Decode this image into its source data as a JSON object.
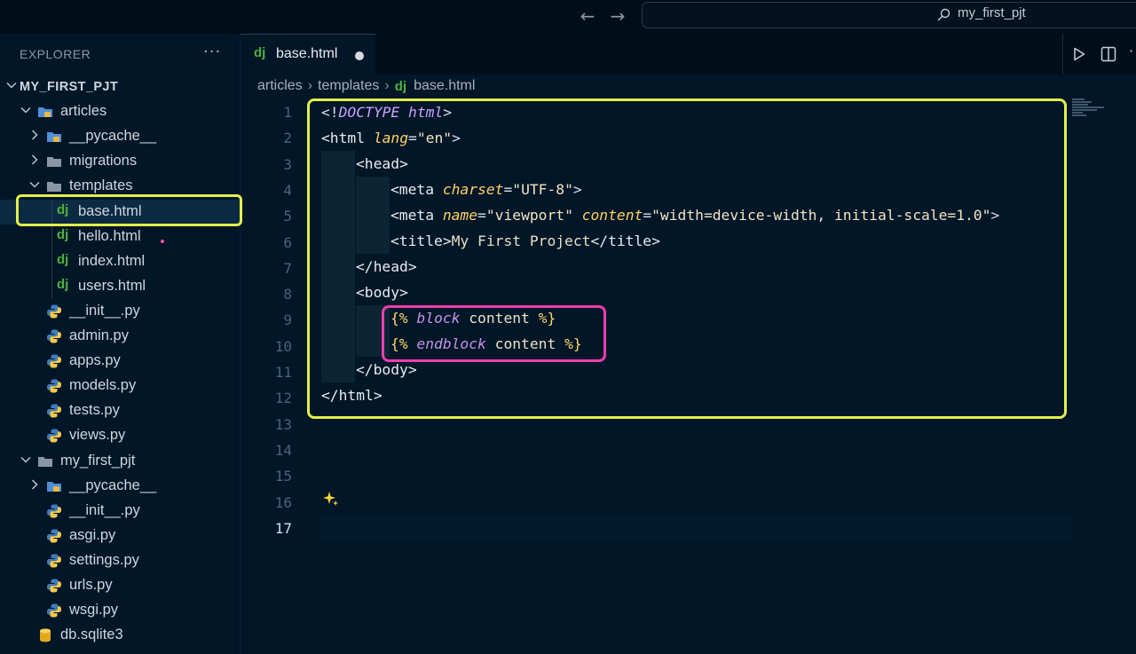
{
  "window": {
    "search_text": "my_first_pjt"
  },
  "explorer": {
    "title": "EXPLORER",
    "more": "···",
    "root": "MY_FIRST_PJT",
    "items": [
      {
        "label": "articles",
        "kind": "folder-open-special",
        "depth": 1
      },
      {
        "label": "__pycache__",
        "kind": "folder-special",
        "depth": 2
      },
      {
        "label": "migrations",
        "kind": "folder",
        "depth": 2
      },
      {
        "label": "templates",
        "kind": "folder-open",
        "depth": 2
      },
      {
        "label": "base.html",
        "kind": "django",
        "depth": 3
      },
      {
        "label": "hello.html",
        "kind": "django",
        "depth": 3
      },
      {
        "label": "index.html",
        "kind": "django",
        "depth": 3
      },
      {
        "label": "users.html",
        "kind": "django",
        "depth": 3
      },
      {
        "label": "__init__.py",
        "kind": "python",
        "depth": 2
      },
      {
        "label": "admin.py",
        "kind": "python",
        "depth": 2
      },
      {
        "label": "apps.py",
        "kind": "python",
        "depth": 2
      },
      {
        "label": "models.py",
        "kind": "python",
        "depth": 2
      },
      {
        "label": "tests.py",
        "kind": "python",
        "depth": 2
      },
      {
        "label": "views.py",
        "kind": "python",
        "depth": 2
      },
      {
        "label": "my_first_pjt",
        "kind": "folder-open",
        "depth": 1
      },
      {
        "label": "__pycache__",
        "kind": "folder-special",
        "depth": 2
      },
      {
        "label": "__init__.py",
        "kind": "python",
        "depth": 2
      },
      {
        "label": "asgi.py",
        "kind": "python",
        "depth": 2
      },
      {
        "label": "settings.py",
        "kind": "python",
        "depth": 2
      },
      {
        "label": "urls.py",
        "kind": "python",
        "depth": 2
      },
      {
        "label": "wsgi.py",
        "kind": "python",
        "depth": 2
      },
      {
        "label": "db.sqlite3",
        "kind": "database",
        "depth": 1
      }
    ]
  },
  "tab": {
    "icon": "dj",
    "label": "base.html"
  },
  "breadcrumb": {
    "parts": [
      "articles",
      "templates",
      "base.html"
    ],
    "file_icon": "dj"
  },
  "editor": {
    "line_numbers": [
      "1",
      "2",
      "3",
      "4",
      "5",
      "6",
      "7",
      "8",
      "9",
      "10",
      "11",
      "12",
      "13",
      "14",
      "15",
      "16",
      "17"
    ],
    "active_line": "17",
    "code": {
      "l1_open": "<!",
      "l1_doctype": "DOCTYPE html",
      "l1_close": ">",
      "l2_tag": "<html ",
      "l2_attr": "lang",
      "l2_eq": "=",
      "l2_val": "\"en\"",
      "l2_close": ">",
      "l3": "<head>",
      "l4_tag": "<meta ",
      "l4_attr": "charset",
      "l4_eq": "=",
      "l4_val": "\"UTF-8\"",
      "l4_close": ">",
      "l5_tag": "<meta ",
      "l5_attr1": "name",
      "l5_eq1": "=",
      "l5_val1": "\"viewport\" ",
      "l5_attr2": "content",
      "l5_eq2": "=",
      "l5_val2": "\"width=device-width, initial-scale=1.0\"",
      "l5_close": ">",
      "l6_open": "<title>",
      "l6_text": "My First Project",
      "l6_close": "</title>",
      "l7": "</head>",
      "l8": "<body>",
      "l9_open": "{% ",
      "l9_kw": "block",
      "l9_name": " content ",
      "l9_close": "%}",
      "l10_open": "{% ",
      "l10_kw": "endblock",
      "l10_name": " content ",
      "l10_close": "%}",
      "l11": "</body>",
      "l12": "</html>"
    }
  }
}
